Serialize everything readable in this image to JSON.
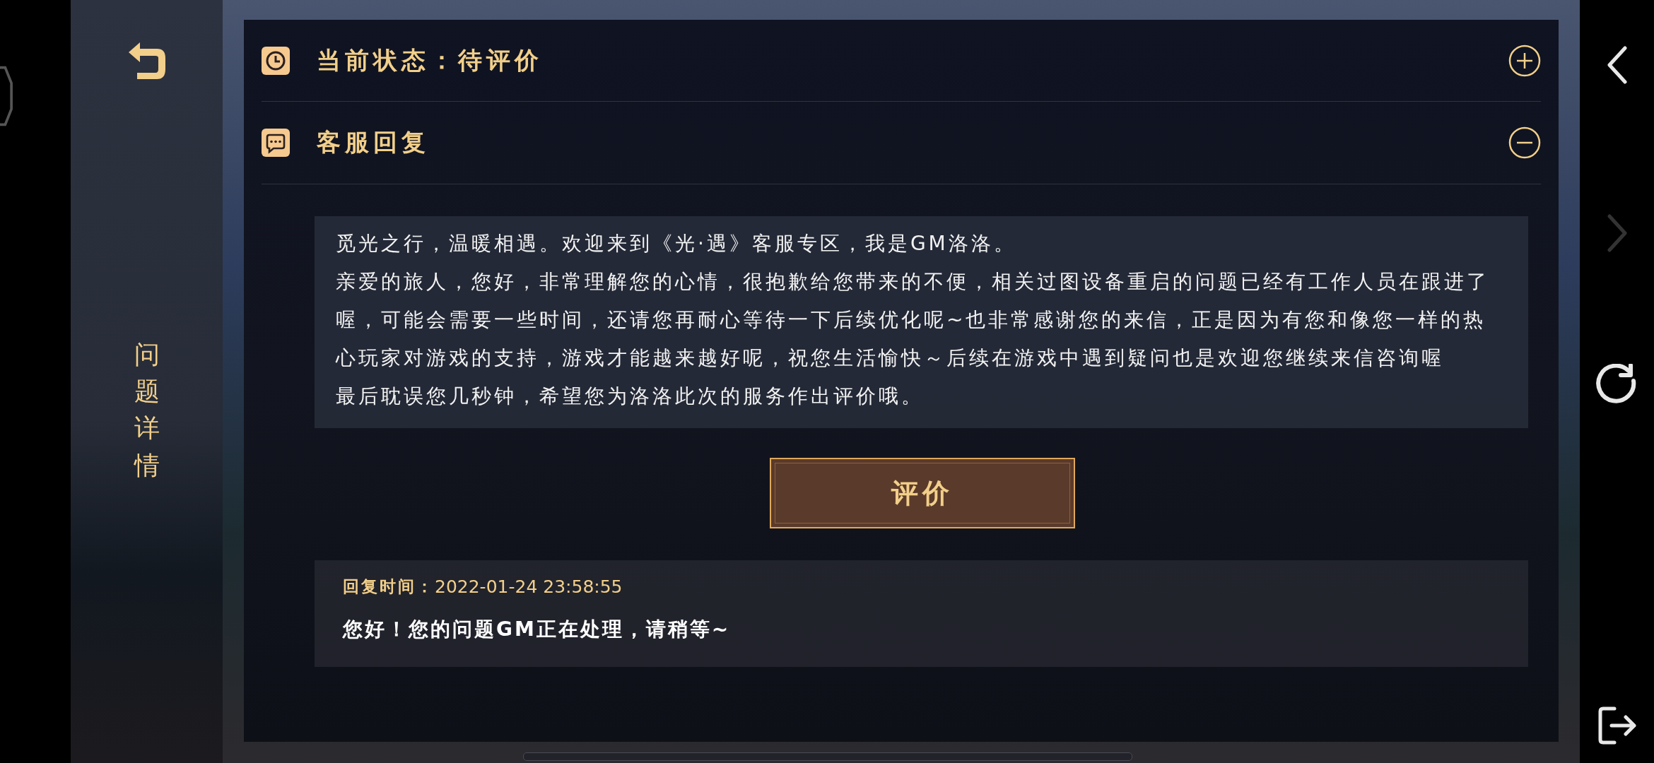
{
  "sidebar": {
    "title": "问题详情"
  },
  "sections": [
    {
      "kind": "status",
      "title": "当前状态：待评价",
      "expanded": false
    },
    {
      "kind": "reply",
      "title": "客服回复",
      "expanded": true
    }
  ],
  "reply_message": {
    "paragraphs": [
      "觅光之行，温暖相遇。欢迎来到《光·遇》客服专区，我是GM洛洛。",
      "亲爱的旅人，您好，非常理解您的心情，很抱歉给您带来的不便，相关过图设备重启的问题已经有工作人员在跟进了喔，可能会需要一些时间，还请您再耐心等待一下后续优化呢~也非常感谢您的来信，正是因为有您和像您一样的热心玩家对游戏的支持，游戏才能越来越好呢，祝您生活愉快～后续在游戏中遇到疑问也是欢迎您继续来信咨询喔",
      "最后耽误您几秒钟，希望您为洛洛此次的服务作出评价哦。"
    ]
  },
  "rate_button": "评价",
  "history": {
    "time_label": "回复时间：",
    "time": "2022-01-24 23:58:55",
    "message": "您好！您的问题GM正在处理，请稍等~"
  },
  "nav": [
    {
      "kind": "back",
      "disabled": false
    },
    {
      "kind": "forward",
      "disabled": true
    },
    {
      "kind": "refresh",
      "disabled": false
    },
    {
      "kind": "exit",
      "disabled": false
    }
  ]
}
